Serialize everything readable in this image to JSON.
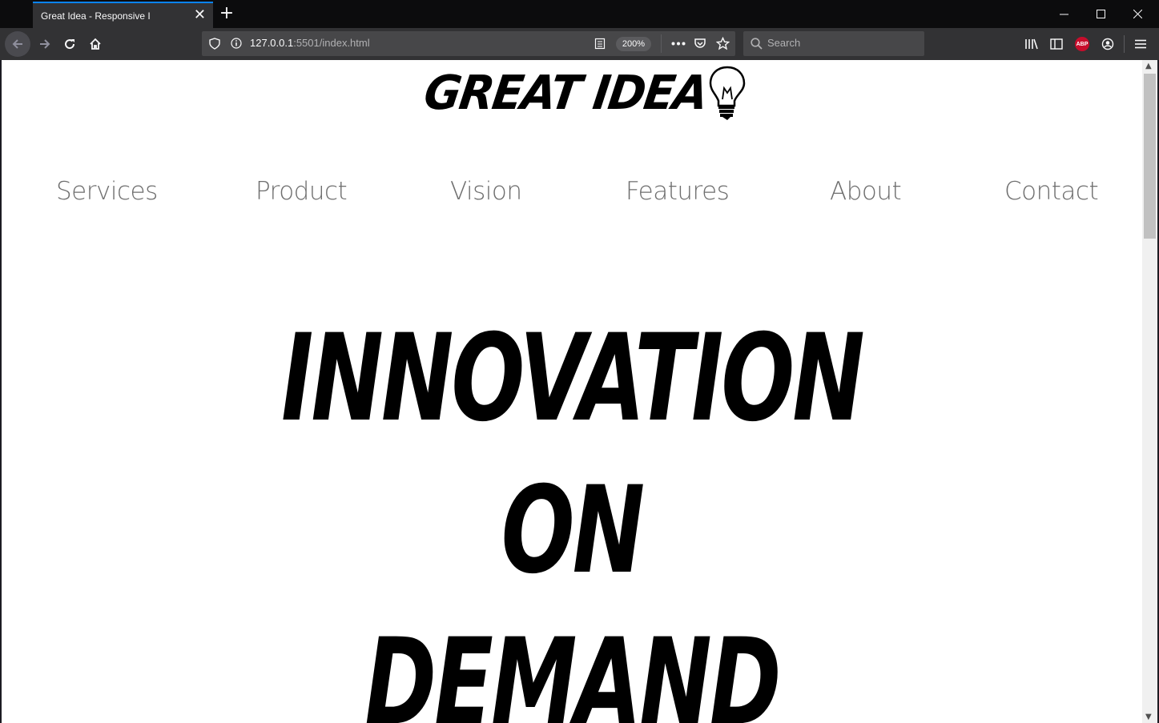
{
  "browser": {
    "tab": {
      "title": "Great Idea - Responsive I"
    },
    "url": {
      "host": "127.0.0.1",
      "rest": ":5501/index.html"
    },
    "zoom": "200%",
    "search_placeholder": "Search",
    "abp_label": "ABP"
  },
  "page": {
    "logo_text": "GREAT IDEA",
    "nav": [
      "Services",
      "Product",
      "Vision",
      "Features",
      "About",
      "Contact"
    ],
    "hero_lines": [
      "INNOVATION",
      "ON",
      "DEMAND"
    ]
  },
  "colors": {
    "accent": "#0a84ff",
    "nav_text": "#6e6e6e",
    "hero_text": "#000000"
  }
}
